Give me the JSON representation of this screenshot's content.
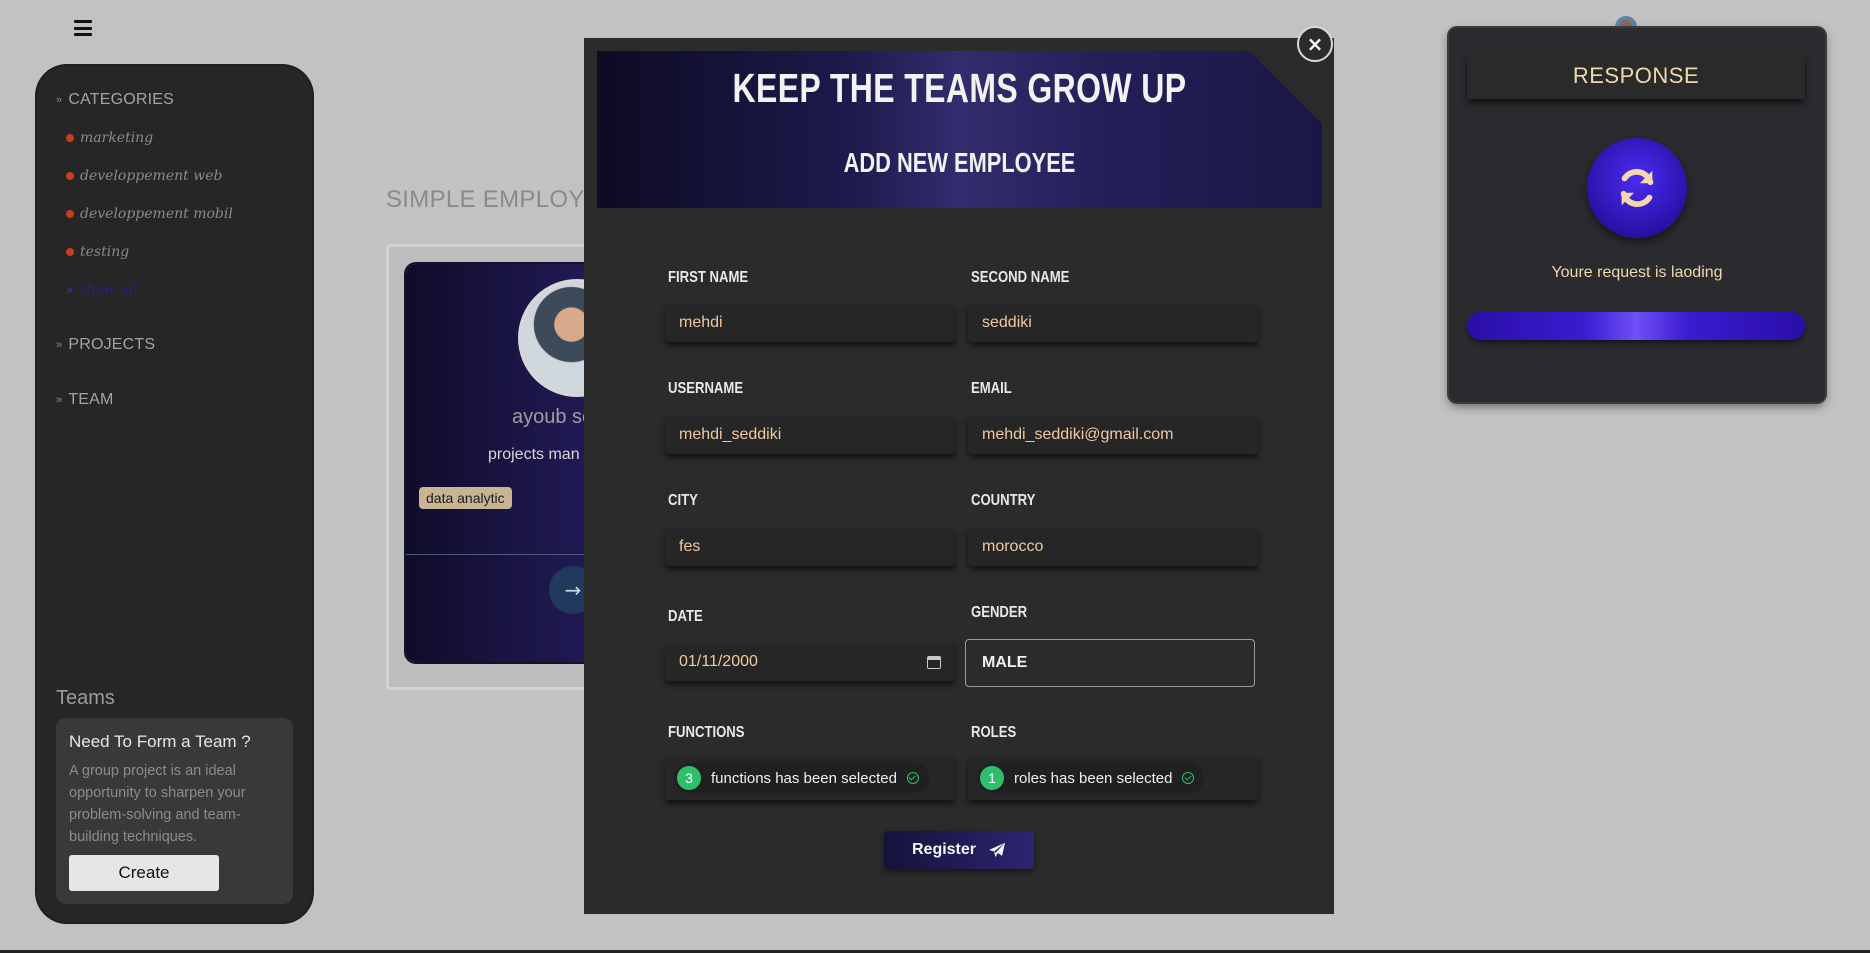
{
  "topbar": {
    "menu_icon": "hamburger-icon",
    "avatar": "user-avatar"
  },
  "sidebar": {
    "categories_label": "CATEGORIES",
    "categories": [
      {
        "label": "marketing"
      },
      {
        "label": "developpement web"
      },
      {
        "label": "developpement mobil"
      },
      {
        "label": "testing"
      },
      {
        "label": "show all",
        "active": true
      }
    ],
    "projects_label": "PROJECTS",
    "team_label": "TEAM",
    "teams_title": "Teams",
    "teams_card": {
      "heading": "Need To Form a Team ?",
      "text": "A group project is an ideal opportunity to sharpen your problem-solving and team-building techniques.",
      "button": "Create"
    }
  },
  "page": {
    "heading": "SIMPLE EMPLOYEE",
    "employee_card": {
      "name": "ayoub se",
      "role": "projects man",
      "tag": "data analytic",
      "go_icon": "arrow-right-icon"
    }
  },
  "modal": {
    "title": "KEEP THE TEAMS GROW UP",
    "subtitle": "ADD NEW EMPLOYEE",
    "close_label": "×",
    "fields": {
      "first_name": {
        "label": "FIRST NAME",
        "value": "mehdi"
      },
      "second_name": {
        "label": "SECOND NAME",
        "value": "seddiki"
      },
      "username": {
        "label": "USERNAME",
        "value": "mehdi_seddiki"
      },
      "email": {
        "label": "EMAIL",
        "value": "mehdi_seddiki@gmail.com"
      },
      "city": {
        "label": "CITY",
        "value": "fes"
      },
      "country": {
        "label": "COUNTRY",
        "value": "morocco"
      },
      "date": {
        "label": "DATE",
        "value": "01/11/2000"
      },
      "gender": {
        "label": "GENDER",
        "value": "MALE"
      },
      "functions": {
        "label": "FUNCTIONS",
        "count": "3",
        "text": "functions has been selected"
      },
      "roles": {
        "label": "ROLES",
        "count": "1",
        "text": "roles has been selected"
      }
    },
    "register_label": "Register"
  },
  "response": {
    "title": "RESPONSE",
    "message": "Youre request is laoding",
    "icon": "sync-icon",
    "progress_fraction": 1.0
  },
  "colors": {
    "accent_purple": "#3b1cd0",
    "label_cream": "#efd9ae",
    "input_text": "#f0c9a0",
    "success_green": "#2fbf6a",
    "category_dot": "#c93d27"
  }
}
